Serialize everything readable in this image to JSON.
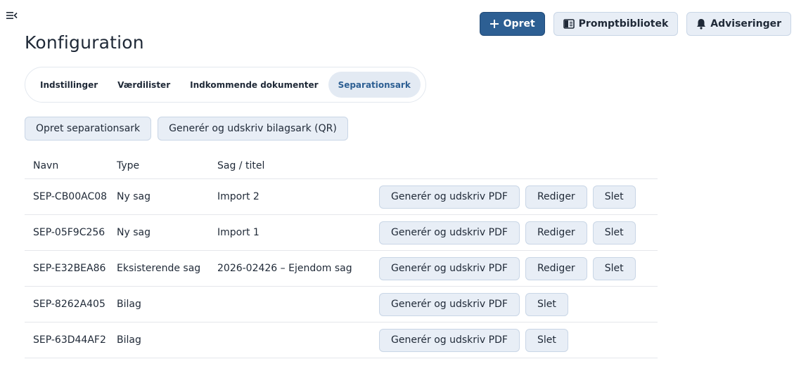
{
  "header": {
    "title": "Konfiguration",
    "menu_icon": "collapse-menu-icon",
    "actions": {
      "create_label": "Opret",
      "prompt_library_label": "Promptbibliotek",
      "notifications_label": "Adviseringer"
    }
  },
  "tabs": [
    {
      "label": "Indstillinger"
    },
    {
      "label": "Værdilister"
    },
    {
      "label": "Indkommende dokumenter"
    },
    {
      "label": "Separationsark"
    }
  ],
  "active_tab": "Separationsark",
  "toolbar": {
    "create_sheet_label": "Opret separationsark",
    "generate_qr_label": "Generér og udskriv bilagsark (QR)"
  },
  "table": {
    "columns": [
      "Navn",
      "Type",
      "Sag / titel"
    ],
    "row_actions": {
      "generate_pdf_label": "Generér og udskriv PDF",
      "edit_label": "Rediger",
      "delete_label": "Slet"
    },
    "rows": [
      {
        "name": "SEP-CB00AC08",
        "type": "Ny sag",
        "case": "Import 2"
      },
      {
        "name": "SEP-05F9C256",
        "type": "Ny sag",
        "case": "Import 1"
      },
      {
        "name": "SEP-E32BEA86",
        "type": "Eksisterende sag",
        "case": "2026-02426 – Ejendom sag"
      },
      {
        "name": "SEP-8262A405",
        "type": "Bilag",
        "case": ""
      },
      {
        "name": "SEP-63D44AF2",
        "type": "Bilag",
        "case": ""
      }
    ]
  },
  "colors": {
    "primary": "#2d5f93",
    "button_bg": "#e8eef6",
    "active_tab_bg": "#e3eaf3"
  }
}
